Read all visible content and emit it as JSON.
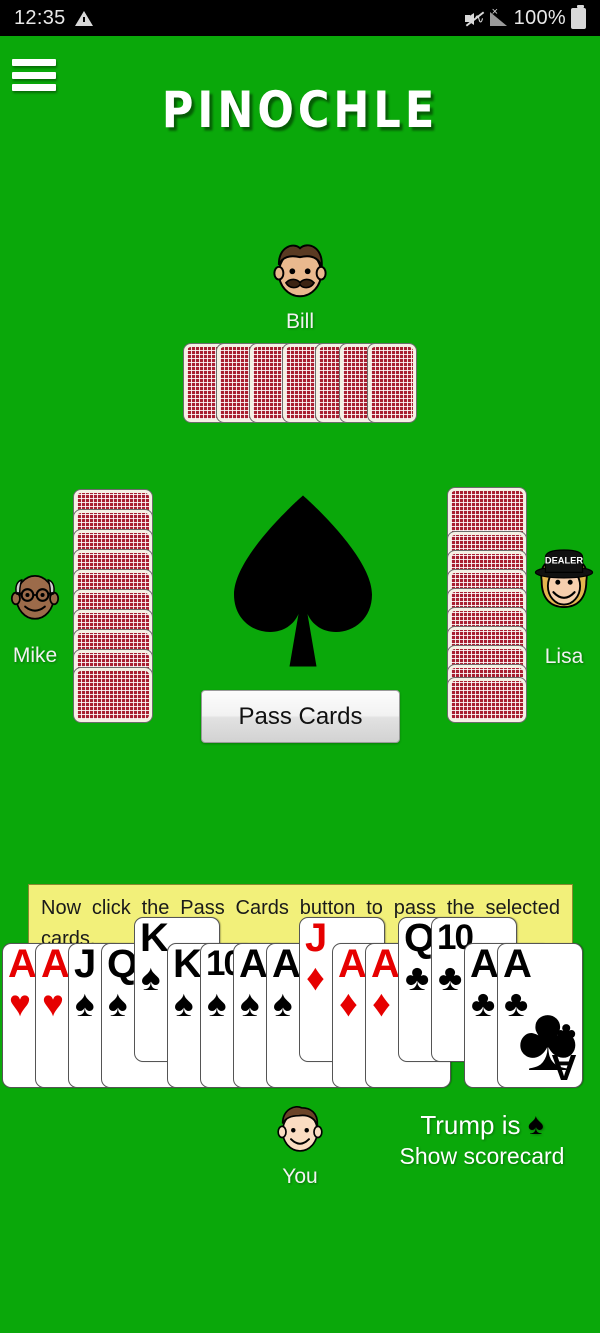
{
  "status_bar": {
    "clock": "12:35",
    "warning_icon": "warning-triangle-icon",
    "mute_icon": "volume-muted-icon",
    "signal_icon": "cellular-signal-no-service-icon",
    "battery_text": "100%",
    "battery_icon": "battery-full-icon"
  },
  "header": {
    "menu_icon": "hamburger-menu-icon",
    "title": "PINOCHLE",
    "background_color": "#0aa80a"
  },
  "players": {
    "top": {
      "name": "Bill",
      "avatar": "avatar-man-mustache",
      "card_count": 8,
      "is_dealer": false
    },
    "left": {
      "name": "Mike",
      "avatar": "avatar-bald-glasses",
      "card_count": 12,
      "is_dealer": false
    },
    "right": {
      "name": "Lisa",
      "avatar": "avatar-blonde-woman",
      "card_count": 12,
      "is_dealer": true,
      "dealer_label": "DEALER"
    },
    "bottom": {
      "name": "You",
      "avatar": "avatar-young-man"
    }
  },
  "table": {
    "trump_suit_symbol": "♠",
    "center_suit_icon": "spade-icon"
  },
  "action_button": {
    "label": "Pass Cards"
  },
  "message": {
    "text": "Now click the Pass Cards button to pass the selected cards."
  },
  "trump_line": {
    "prefix": "Trump is ",
    "symbol": "♠"
  },
  "scorecard_link": {
    "label": "Show scorecard"
  },
  "hand": {
    "cards": [
      {
        "rank": "A",
        "suit": "♥",
        "color": "red",
        "selected": false
      },
      {
        "rank": "A",
        "suit": "♥",
        "color": "red",
        "selected": false
      },
      {
        "rank": "J",
        "suit": "♠",
        "color": "black",
        "selected": false
      },
      {
        "rank": "Q",
        "suit": "♠",
        "color": "black",
        "selected": false
      },
      {
        "rank": "K",
        "suit": "♠",
        "color": "black",
        "selected": true
      },
      {
        "rank": "K",
        "suit": "♠",
        "color": "black",
        "selected": false
      },
      {
        "rank": "10",
        "suit": "♠",
        "color": "black",
        "selected": false
      },
      {
        "rank": "A",
        "suit": "♠",
        "color": "black",
        "selected": false
      },
      {
        "rank": "A",
        "suit": "♠",
        "color": "black",
        "selected": false
      },
      {
        "rank": "J",
        "suit": "♦",
        "color": "red",
        "selected": true
      },
      {
        "rank": "A",
        "suit": "♦",
        "color": "red",
        "selected": false
      },
      {
        "rank": "A",
        "suit": "♦",
        "color": "red",
        "selected": false
      },
      {
        "rank": "Q",
        "suit": "♣",
        "color": "black",
        "selected": true
      },
      {
        "rank": "10",
        "suit": "♣",
        "color": "black",
        "selected": true
      },
      {
        "rank": "A",
        "suit": "♣",
        "color": "black",
        "selected": false
      },
      {
        "rank": "A",
        "suit": "♣",
        "color": "black",
        "selected": false
      }
    ]
  },
  "colors": {
    "table_green": "#0aa80a",
    "card_back_red": "#a81f31",
    "message_yellow": "#f2f07a",
    "red_suit": "#e60000"
  }
}
